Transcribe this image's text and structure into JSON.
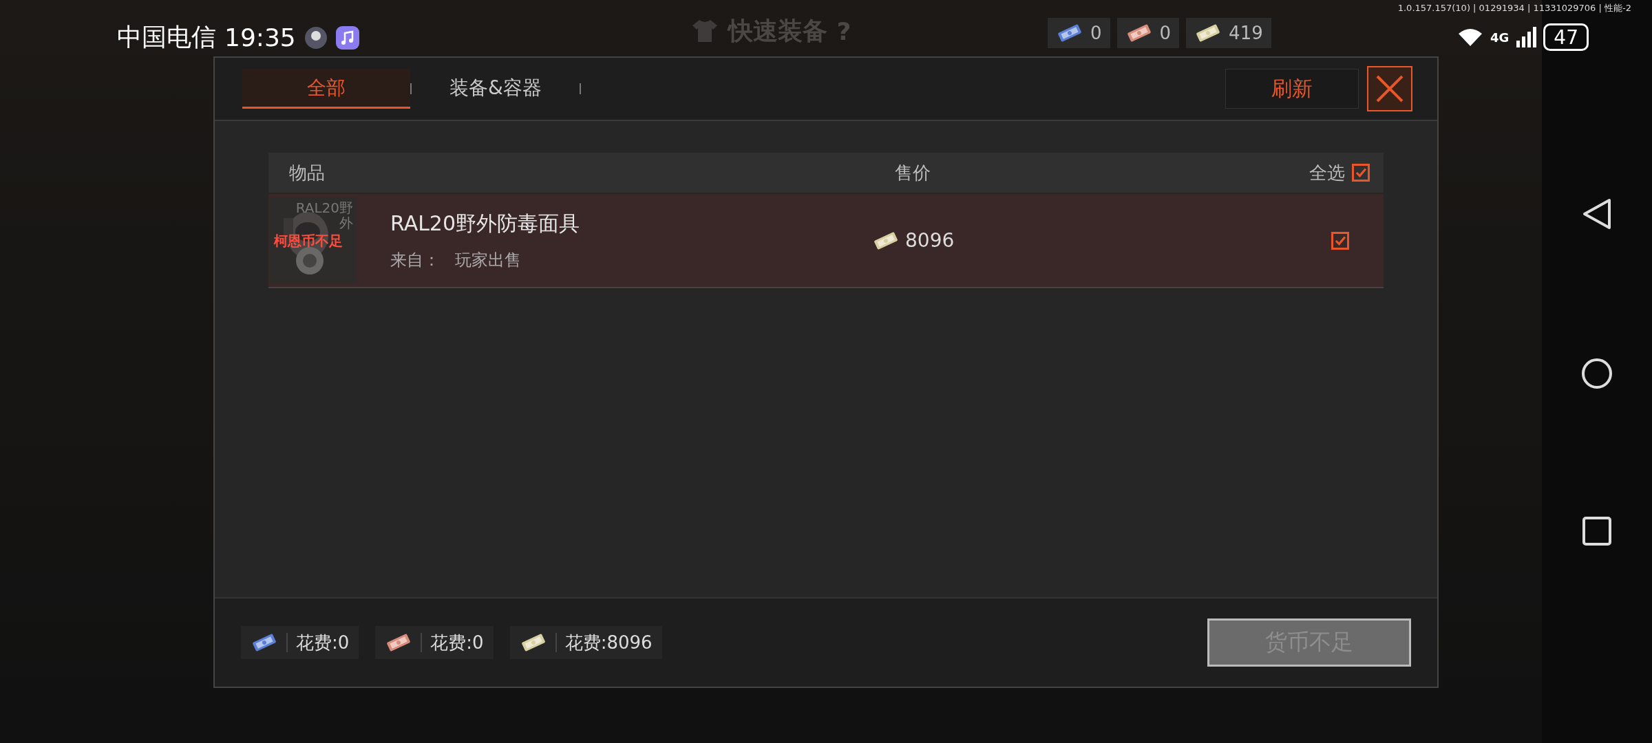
{
  "status_bar": {
    "carrier": "中国电信",
    "time": "19:35",
    "network": "4G",
    "battery": "47"
  },
  "version_info": "1.0.157.157(10) | 01291934 | 11331029706 | 性能-2",
  "background": {
    "title": "快速装备",
    "help": "?",
    "currencies": [
      {
        "color": "#5b7fd6",
        "amount": "0"
      },
      {
        "color": "#d98c7c",
        "amount": "0"
      },
      {
        "color": "#d9d0a2",
        "amount": "419"
      }
    ]
  },
  "dialog": {
    "tabs": [
      {
        "label": "全部",
        "selected": true
      },
      {
        "label": "装备&容器",
        "selected": false
      }
    ],
    "refresh_button": "刷新",
    "table": {
      "columns": [
        "物品",
        "售价"
      ],
      "select_all": {
        "label": "全选",
        "checked": true
      },
      "rows": [
        {
          "thumb_label": "RAL20野外",
          "warning": "柯恩币不足",
          "name": "RAL20野外防毒面具",
          "source_label": "来自：",
          "source": "玩家出售",
          "price": "8096",
          "color": "#d9d0a2",
          "checked": true
        }
      ]
    },
    "costs": [
      {
        "color": "#5b7fd6",
        "label": "花费:0"
      },
      {
        "color": "#d98c7c",
        "label": "花费:0"
      },
      {
        "color": "#d9d0a2",
        "label": "花费:8096"
      }
    ],
    "confirm_button": {
      "label": "货币不足",
      "disabled": true
    }
  }
}
